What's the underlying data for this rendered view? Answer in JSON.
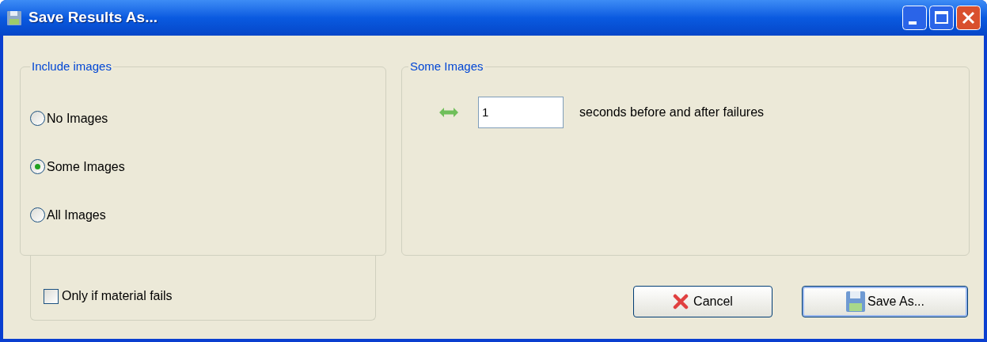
{
  "window": {
    "title": "Save Results As..."
  },
  "include_group": {
    "label": "Include images",
    "options": [
      {
        "label": "No Images",
        "selected": false
      },
      {
        "label": "Some Images",
        "selected": true
      },
      {
        "label": "All Images",
        "selected": false
      }
    ]
  },
  "only_if_fails": {
    "label": "Only if material fails",
    "checked": false
  },
  "detail_group": {
    "label": "Some Images",
    "value": "1",
    "suffix": "seconds before and after failures"
  },
  "buttons": [
    {
      "kind": "cancel",
      "label": "Cancel"
    },
    {
      "kind": "save",
      "label": "Save As..."
    }
  ]
}
